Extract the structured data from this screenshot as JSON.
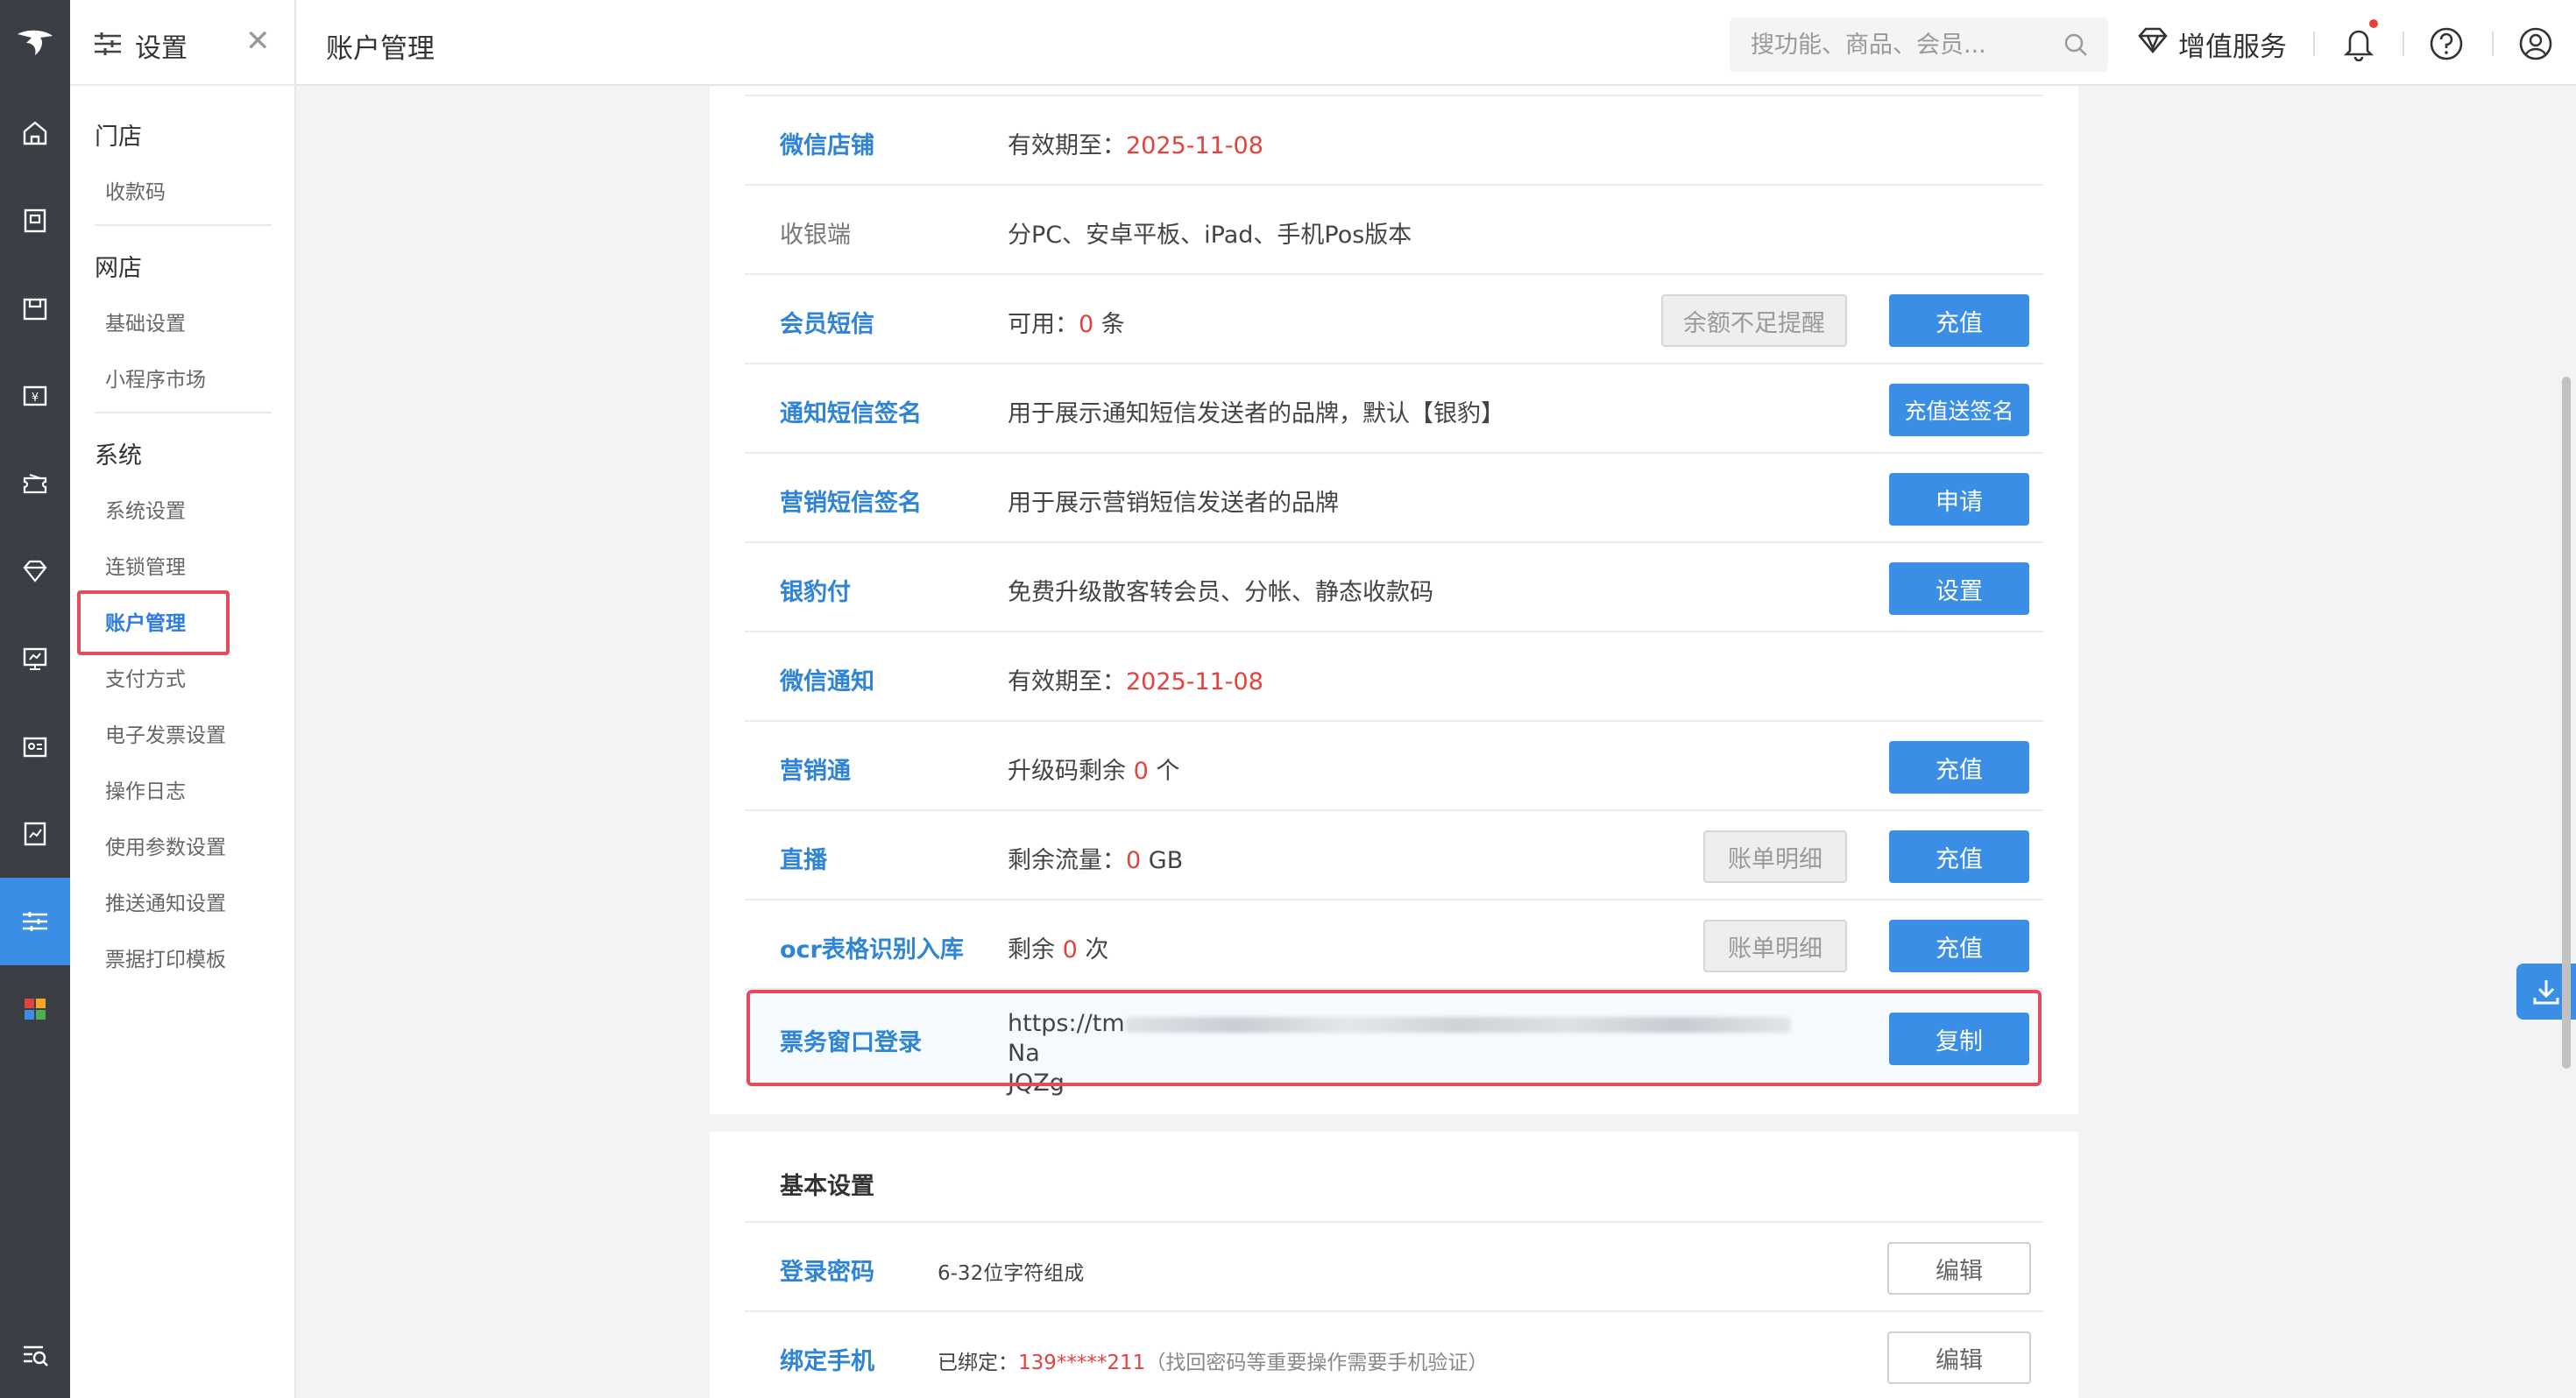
{
  "topbar": {
    "page_title": "账户管理",
    "search_placeholder": "搜功能、商品、会员...",
    "value_added_label": "增值服务"
  },
  "sidebar": {
    "title": "设置",
    "groups": [
      {
        "label": "门店",
        "items": [
          "收款码"
        ]
      },
      {
        "label": "网店",
        "items": [
          "基础设置",
          "小程序市场"
        ]
      },
      {
        "label": "系统",
        "items": [
          "系统设置",
          "连锁管理",
          "账户管理",
          "支付方式",
          "电子发票设置",
          "操作日志",
          "使用参数设置",
          "推送通知设置",
          "票据打印模板"
        ]
      }
    ],
    "active_item": "账户管理"
  },
  "rail_icons": [
    "logo-icon",
    "home-icon",
    "goods-icon",
    "store-icon",
    "cashier-icon",
    "marketing-icon",
    "member-icon",
    "screen-icon",
    "staff-icon",
    "report-icon",
    "settings-icon",
    "apps-icon",
    "search-menu-icon"
  ],
  "services": [
    {
      "name": "微信店铺",
      "desc_prefix": "有效期至：",
      "highlight": "2025-11-08",
      "desc_suffix": ""
    },
    {
      "name": "收银端",
      "desc_prefix": "分PC、安卓平板、iPad、手机Pos版本",
      "highlight": "",
      "desc_suffix": ""
    },
    {
      "name": "会员短信",
      "desc_prefix": "可用：",
      "highlight": "0",
      "desc_suffix": " 条",
      "secondary_button": "余额不足提醒",
      "primary_button": "充值"
    },
    {
      "name": "通知短信签名",
      "desc_prefix": "用于展示通知短信发送者的品牌，默认【银豹】",
      "highlight": "",
      "desc_suffix": "",
      "primary_button": "充值送签名"
    },
    {
      "name": "营销短信签名",
      "desc_prefix": "用于展示营销短信发送者的品牌",
      "highlight": "",
      "desc_suffix": "",
      "primary_button": "申请"
    },
    {
      "name": "银豹付",
      "desc_prefix": "免费升级散客转会员、分帐、静态收款码",
      "highlight": "",
      "desc_suffix": "",
      "primary_button": "设置"
    },
    {
      "name": "微信通知",
      "desc_prefix": "有效期至：",
      "highlight": "2025-11-08",
      "desc_suffix": ""
    },
    {
      "name": "营销通",
      "desc_prefix": "升级码剩余 ",
      "highlight": "0",
      "desc_suffix": " 个",
      "primary_button": "充值"
    },
    {
      "name": "直播",
      "desc_prefix": "剩余流量：",
      "highlight": "0",
      "desc_suffix": " GB",
      "secondary_button": "账单明细",
      "primary_button": "充值"
    },
    {
      "name": "ocr表格识别入库",
      "desc_prefix": "剩余 ",
      "highlight": "0",
      "desc_suffix": " 次",
      "secondary_button": "账单明细",
      "primary_button": "充值"
    }
  ],
  "ticket_login": {
    "name": "票务窗口登录",
    "url_start": "https://tm",
    "url_end": "Na",
    "url_line2": "JQZg",
    "button": "复制"
  },
  "basic": {
    "title": "基本设置",
    "password": {
      "name": "登录密码",
      "desc": "6-32位字符组成",
      "button": "编辑"
    },
    "phone": {
      "name": "绑定手机",
      "prefix": "已绑定：",
      "number": "139*****211",
      "note": "（找回密码等重要操作需要手机验证）",
      "button": "编辑"
    }
  },
  "colors": {
    "primary": "#3a8ee6",
    "link": "#2f84d6",
    "alert_red": "#e5413d",
    "highlight_border": "#e54b5a",
    "rail": "#3b3f45"
  }
}
